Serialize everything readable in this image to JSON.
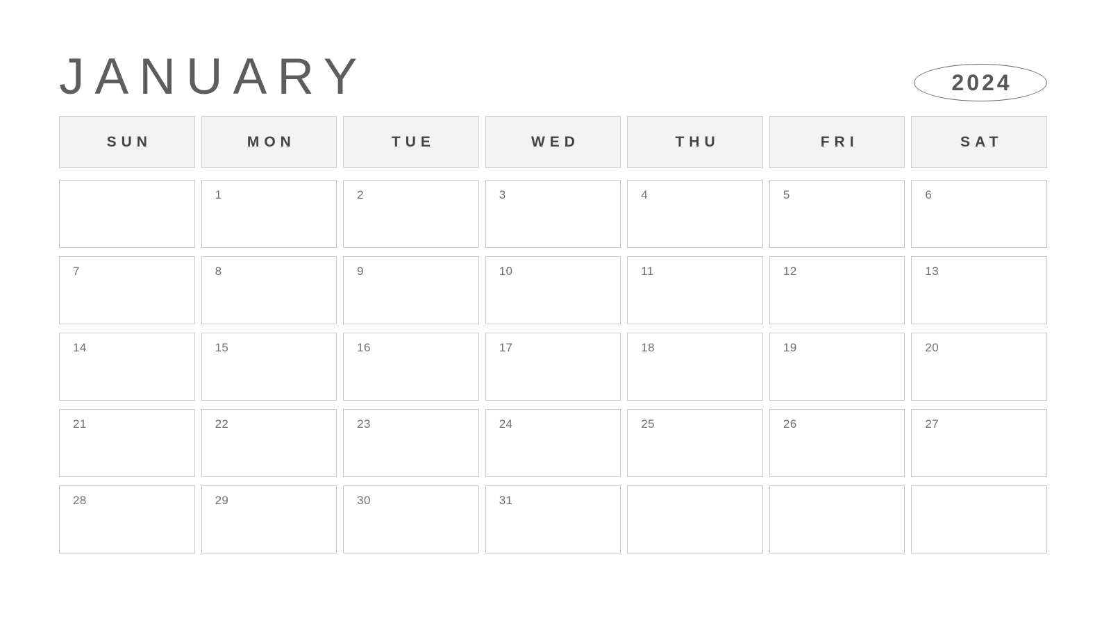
{
  "header": {
    "month_title": "JANUARY",
    "year": "2024"
  },
  "weekdays": [
    {
      "label": "SUN"
    },
    {
      "label": "MON"
    },
    {
      "label": "TUE"
    },
    {
      "label": "WED"
    },
    {
      "label": "THU"
    },
    {
      "label": "FRI"
    },
    {
      "label": "SAT"
    }
  ],
  "weeks": [
    [
      {
        "date": ""
      },
      {
        "date": "1"
      },
      {
        "date": "2"
      },
      {
        "date": "3"
      },
      {
        "date": "4"
      },
      {
        "date": "5"
      },
      {
        "date": "6"
      }
    ],
    [
      {
        "date": "7"
      },
      {
        "date": "8"
      },
      {
        "date": "9"
      },
      {
        "date": "10"
      },
      {
        "date": "11"
      },
      {
        "date": "12"
      },
      {
        "date": "13"
      }
    ],
    [
      {
        "date": "14"
      },
      {
        "date": "15"
      },
      {
        "date": "16"
      },
      {
        "date": "17"
      },
      {
        "date": "18"
      },
      {
        "date": "19"
      },
      {
        "date": "20"
      }
    ],
    [
      {
        "date": "21"
      },
      {
        "date": "22"
      },
      {
        "date": "23"
      },
      {
        "date": "24"
      },
      {
        "date": "25"
      },
      {
        "date": "26"
      },
      {
        "date": "27"
      }
    ],
    [
      {
        "date": "28"
      },
      {
        "date": "29"
      },
      {
        "date": "30"
      },
      {
        "date": "31"
      },
      {
        "date": ""
      },
      {
        "date": ""
      },
      {
        "date": ""
      }
    ]
  ],
  "colors": {
    "page_background": "#ffffff",
    "title_text": "#5d5d5d",
    "year_text": "#575757",
    "year_badge_border": "#6b6b6b",
    "weekday_background": "#f3f3f3",
    "weekday_border": "#cfcfcf",
    "weekday_text": "#434343",
    "date_cell_background": "#ffffff",
    "date_cell_border": "#c9c9c9",
    "date_number_text": "#6f6f6f"
  }
}
